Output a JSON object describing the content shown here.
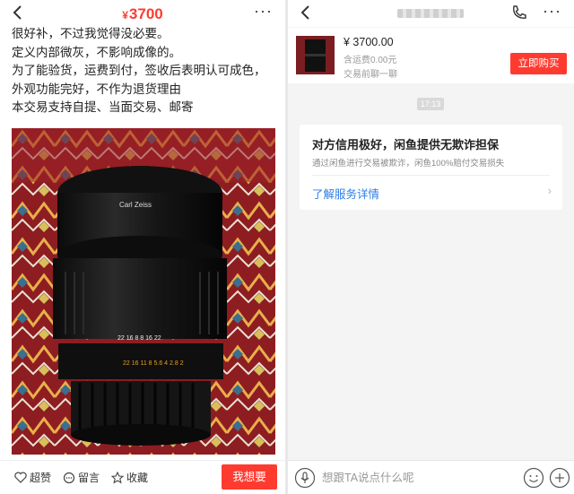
{
  "left": {
    "header": {
      "price_symbol": "¥",
      "price": "3700",
      "more": "···"
    },
    "description": [
      "很好补，不过我觉得没必要。",
      "定义内部微灰，不影响成像的。",
      "为了能验货，运费到付，签收后表明认可成色，",
      "外观功能完好，不作为退货理由",
      "本交易支持自提、当面交易、邮寄"
    ],
    "photo": {
      "brand_text": "Carl Zeiss",
      "scale_top": "22  16  8   8  16  22",
      "scale_aperture": "22   16   11    8   5.6   4   2.8   2"
    },
    "bottom": {
      "like": "超赞",
      "comment": "留言",
      "favorite": "收藏",
      "want": "我想要"
    }
  },
  "right": {
    "header": {
      "more": "···"
    },
    "item": {
      "price": "¥ 3700.00",
      "shipping": "含运费0.00元",
      "chat_note": "交易前聊一聊",
      "buy": "立即购买"
    },
    "time": "17:13",
    "guarantee": {
      "title": "对方信用极好，闲鱼提供无欺诈担保",
      "desc": "通过闲鱼进行交易被欺诈，闲鱼100%赔付交易损失",
      "link": "了解服务详情",
      "arrow": "›"
    },
    "input": {
      "placeholder": "想跟TA说点什么呢"
    }
  },
  "colors": {
    "accent": "#ff3b30",
    "link": "#2b7de9"
  }
}
